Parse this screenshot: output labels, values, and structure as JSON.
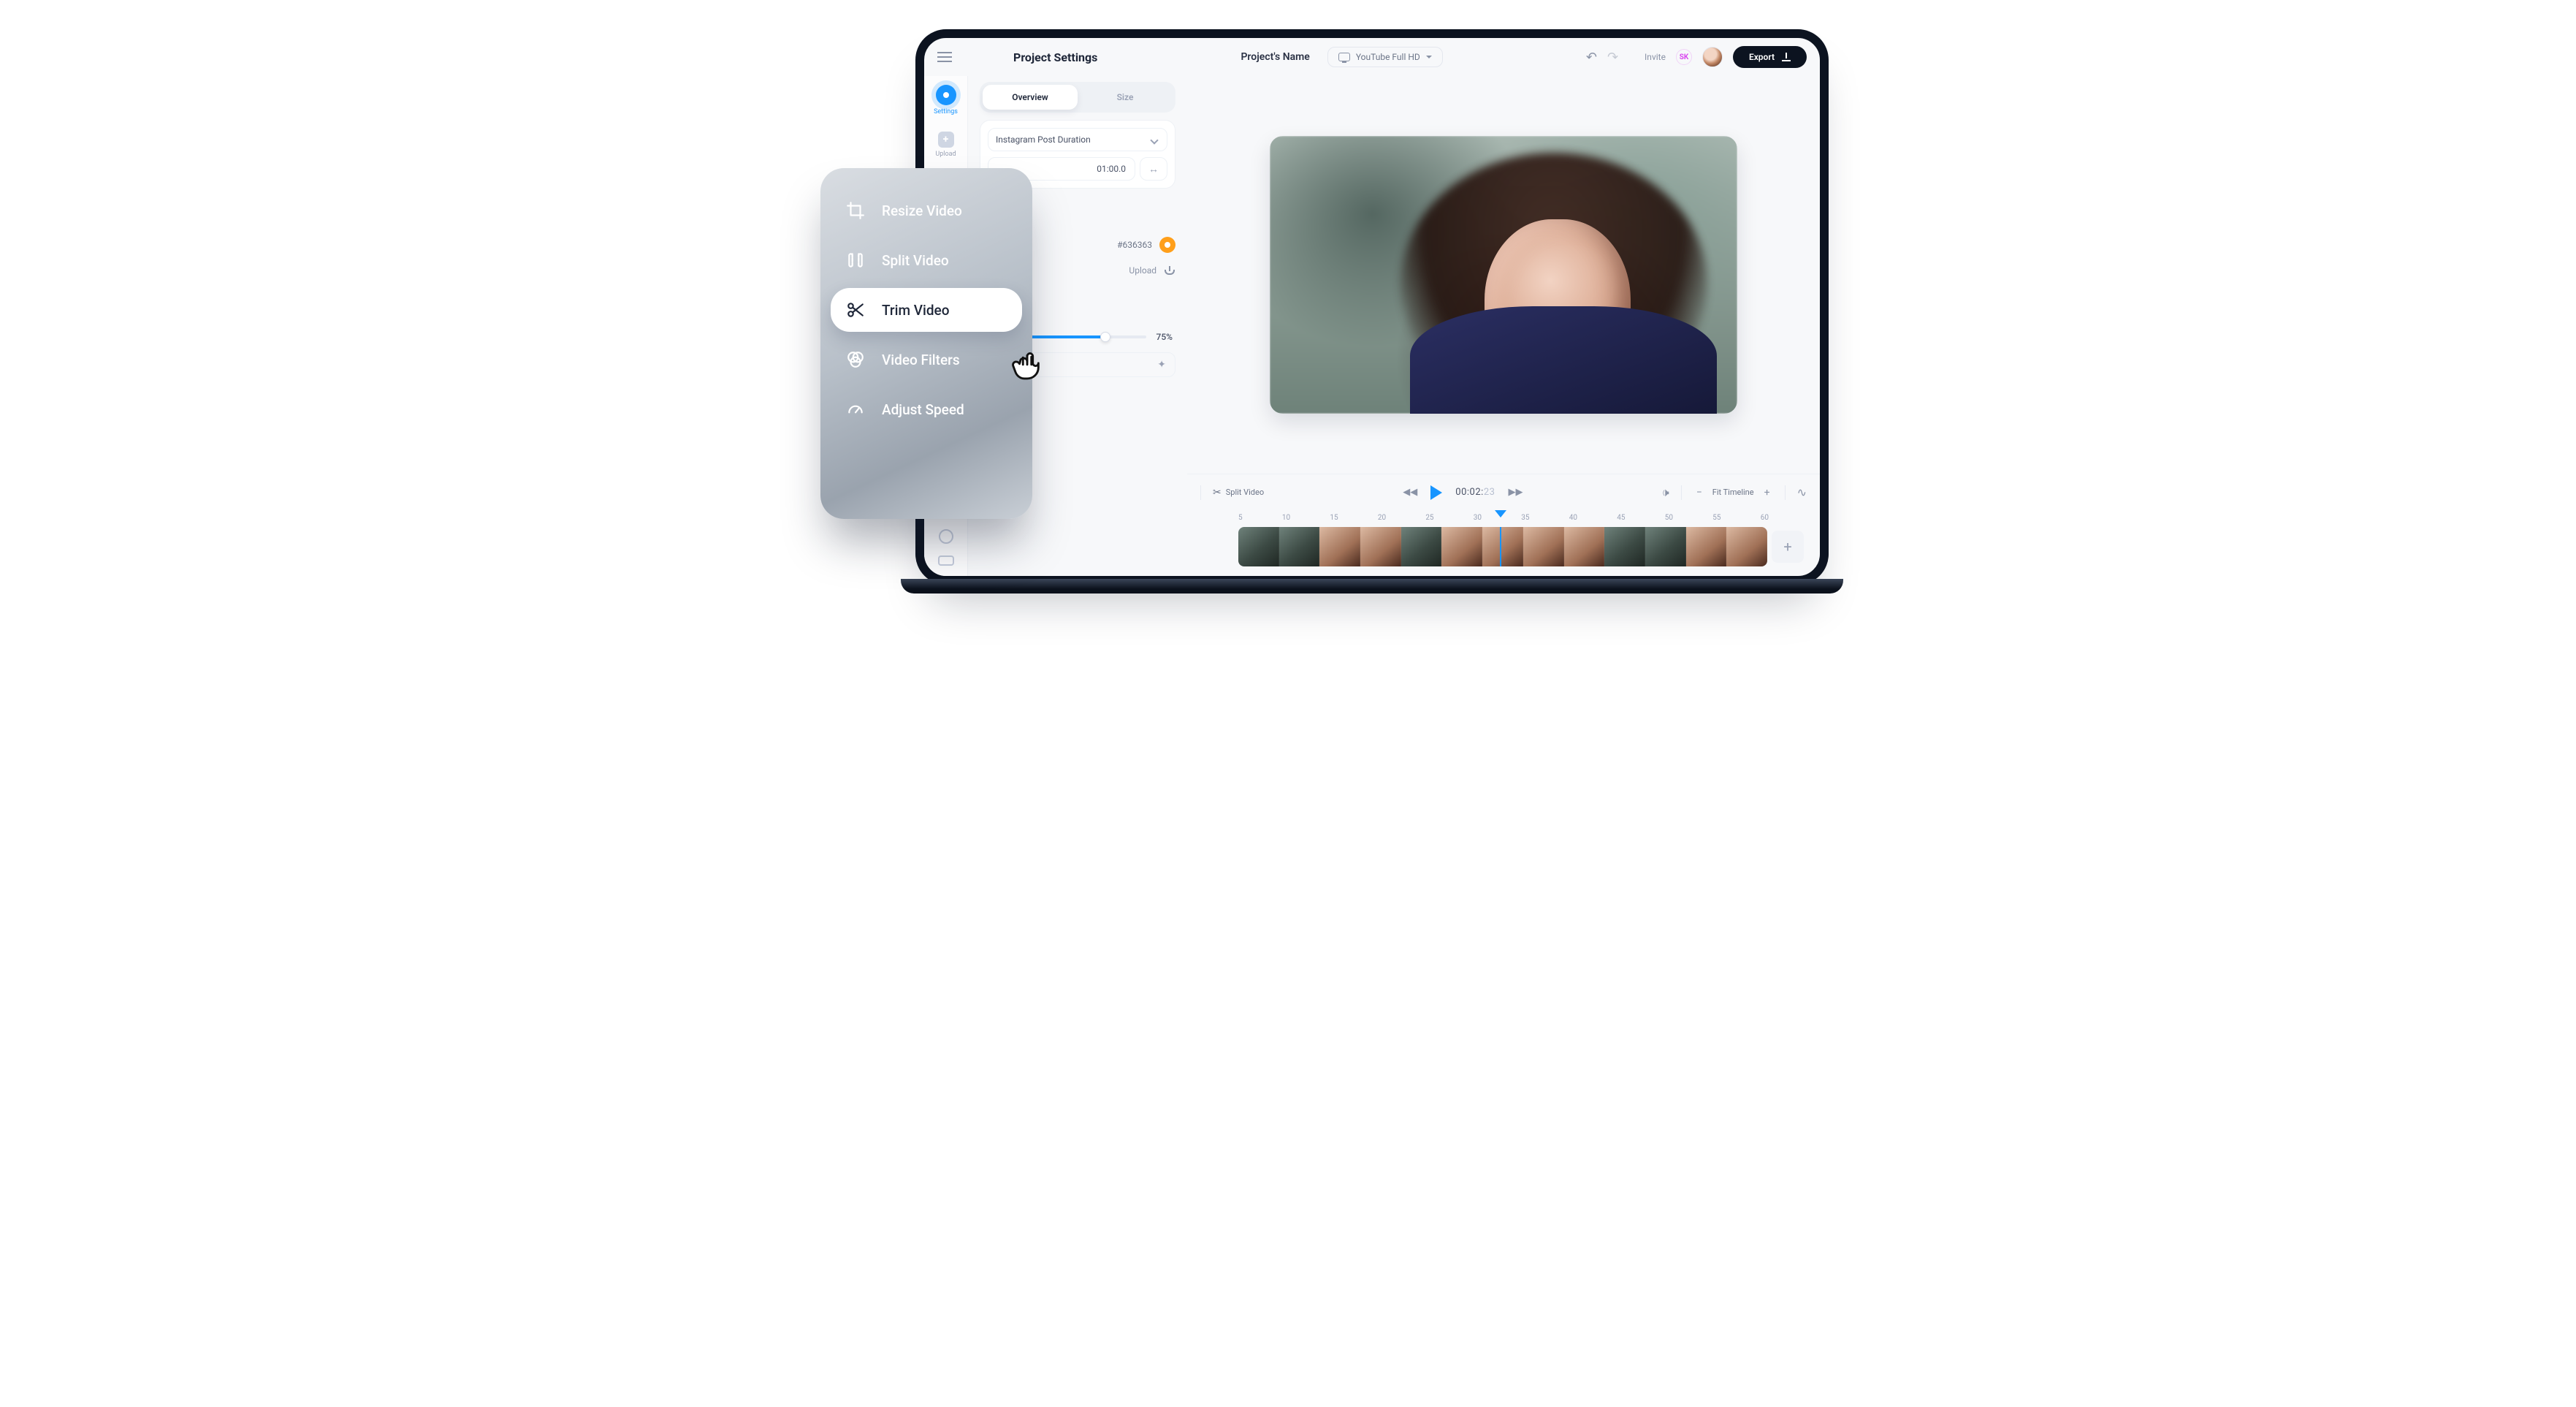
{
  "topbar": {
    "panel_title": "Project Settings",
    "project_name": "Project's Name",
    "format_label": "YouTube Full HD",
    "invite_label": "Invite",
    "avatar_initials": "SK",
    "export_label": "Export"
  },
  "rail": {
    "settings_label": "Settings",
    "upload_label": "Upload"
  },
  "settings_panel": {
    "tabs": {
      "overview": "Overview",
      "size": "Size"
    },
    "duration_preset": "Instagram Post Duration",
    "duration_value": "01:00.0",
    "color_hex": "#636363",
    "upload_label": "Upload",
    "slider_percent": "75%"
  },
  "timeline": {
    "split_label": "Split Video",
    "timecode_main": "00:02:",
    "timecode_frac": "23",
    "fit_label": "Fit Timeline",
    "ruler_marks": [
      "5",
      "10",
      "15",
      "20",
      "25",
      "30",
      "35",
      "40",
      "45",
      "50",
      "55",
      "60"
    ]
  },
  "feature_card": {
    "items": [
      {
        "key": "resize",
        "label": "Resize Video"
      },
      {
        "key": "split",
        "label": "Split Video"
      },
      {
        "key": "trim",
        "label": "Trim Video"
      },
      {
        "key": "filters",
        "label": "Video Filters"
      },
      {
        "key": "speed",
        "label": "Adjust Speed"
      }
    ],
    "active_key": "trim"
  }
}
